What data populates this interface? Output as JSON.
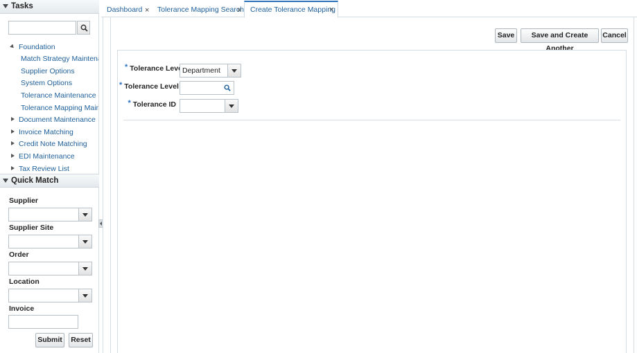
{
  "tasks_panel": {
    "title": "Tasks",
    "search_placeholder": "",
    "tree": [
      {
        "label": "Foundation",
        "level": 0,
        "expanded": true
      },
      {
        "label": "Match Strategy Maintenance",
        "level": 1
      },
      {
        "label": "Supplier Options",
        "level": 1
      },
      {
        "label": "System Options",
        "level": 1
      },
      {
        "label": "Tolerance Maintenance",
        "level": 1
      },
      {
        "label": "Tolerance Mapping Maintenance",
        "level": 1
      },
      {
        "label": "Document Maintenance",
        "level": 0,
        "expanded": false
      },
      {
        "label": "Invoice Matching",
        "level": 0,
        "expanded": false
      },
      {
        "label": "Credit Note Matching",
        "level": 0,
        "expanded": false
      },
      {
        "label": "EDI Maintenance",
        "level": 0,
        "expanded": false
      },
      {
        "label": "Tax Review List",
        "level": 0,
        "expanded": false
      }
    ]
  },
  "quick_match": {
    "title": "Quick Match",
    "fields": {
      "supplier": {
        "label": "Supplier",
        "value": ""
      },
      "supplier_site": {
        "label": "Supplier Site",
        "value": ""
      },
      "order": {
        "label": "Order",
        "value": ""
      },
      "location": {
        "label": "Location",
        "value": ""
      },
      "invoice": {
        "label": "Invoice",
        "value": ""
      }
    },
    "submit_label": "Submit",
    "reset_label": "Reset"
  },
  "tabs": [
    {
      "label": "Dashboard",
      "close": "×",
      "active": false
    },
    {
      "label": "Tolerance Mapping Search",
      "close": "×",
      "active": false
    },
    {
      "label": "Create Tolerance Mapping",
      "close": "×",
      "active": true
    }
  ],
  "toolbar": {
    "save_label": "Save",
    "save_create_label": "Save and Create Another",
    "cancel_label": "Cancel"
  },
  "form": {
    "required_marker": "*",
    "tolerance_level": {
      "label": "Tolerance Level",
      "value": "Department"
    },
    "tolerance_level_id": {
      "label": "Tolerance Level ID",
      "value": ""
    },
    "tolerance_id": {
      "label": "Tolerance ID",
      "value": ""
    }
  },
  "icons": {
    "search": "search-icon",
    "dropdown": "chevron-down-icon",
    "close": "close-icon",
    "collapse": "collapse-triangle-icon"
  },
  "colors": {
    "link": "#1e5f99",
    "accent": "#2b71c1",
    "border": "#d6dde3"
  }
}
